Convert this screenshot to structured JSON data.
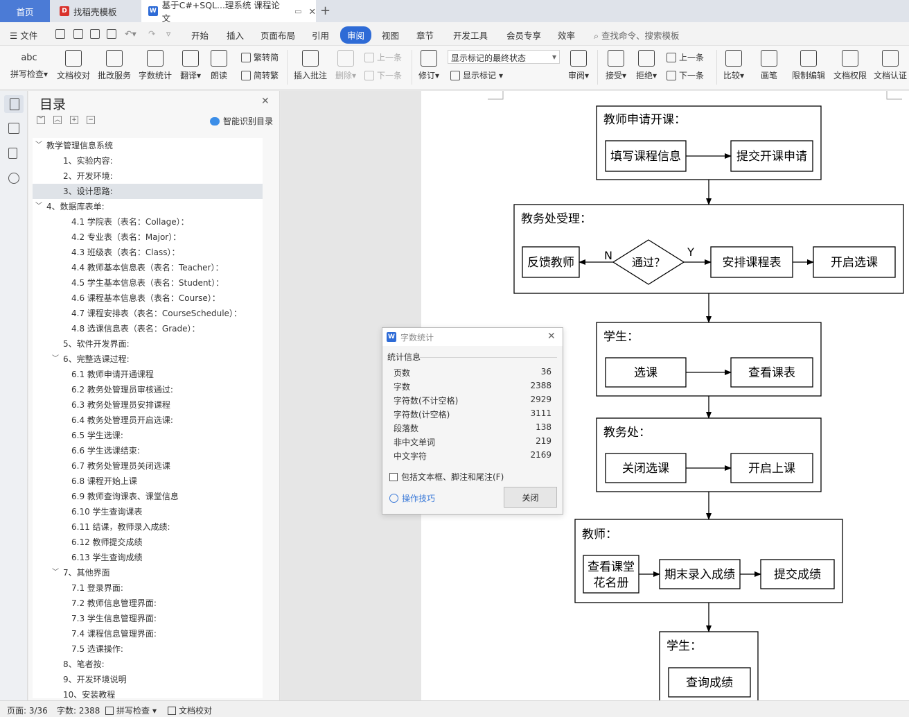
{
  "tabs": {
    "home": "首页",
    "template": "找稻壳模板",
    "doc": "基于C#+SQL...理系统 课程论文"
  },
  "menu": {
    "file": "文件",
    "items": [
      "开始",
      "插入",
      "页面布局",
      "引用",
      "审阅",
      "视图",
      "章节",
      "开发工具",
      "会员专享",
      "效率"
    ],
    "active": "审阅",
    "search": "查找命令、搜索模板"
  },
  "ribbon": {
    "spell": "拼写检查",
    "proof": "文档校对",
    "revise_service": "批改服务",
    "word_count": "字数统计",
    "translate": "翻译",
    "read": "朗读",
    "to_trad": "繁转简",
    "to_simp": "简转繁",
    "insert_comment": "插入批注",
    "delete": "删除",
    "prev": "上一条",
    "next": "下一条",
    "track": "修订",
    "markup_state": "显示标记的最终状态",
    "show_markup": "显示标记",
    "review": "审阅",
    "accept": "接受",
    "reject": "拒绝",
    "prev2": "上一条",
    "next2": "下一条",
    "compare": "比较",
    "pen": "画笔",
    "restrict": "限制编辑",
    "rights": "文档权限",
    "auth": "文档认证"
  },
  "toc": {
    "title": "目录",
    "smart": "智能识别目录",
    "items": [
      {
        "text": "教学管理信息系统",
        "level": 0,
        "arrow": "﹀"
      },
      {
        "text": "1、实验内容:",
        "level": 1
      },
      {
        "text": "2、开发环境:",
        "level": 1
      },
      {
        "text": "3、设计思路:",
        "level": 1,
        "selected": true
      },
      {
        "text": "4、数据库表单:",
        "level": 0,
        "arrow": "﹀"
      },
      {
        "text": "4.1  学院表（表名：Collage）：",
        "level": 2
      },
      {
        "text": "4.2  专业表（表名：Major）：",
        "level": 2
      },
      {
        "text": "4.3  班级表（表名：Class）：",
        "level": 2
      },
      {
        "text": "4.4  教师基本信息表（表名：Teacher）：",
        "level": 2
      },
      {
        "text": "4.5  学生基本信息表（表名：Student）：",
        "level": 2
      },
      {
        "text": "4.6  课程基本信息表（表名：Course）：",
        "level": 2
      },
      {
        "text": "4.7  课程安排表（表名：CourseSchedule）：",
        "level": 2
      },
      {
        "text": "4.8  选课信息表（表名：Grade）：",
        "level": 2
      },
      {
        "text": "5、软件开发界面:",
        "level": 1
      },
      {
        "text": "6、完整选课过程:",
        "level": 1,
        "arrow": "﹀"
      },
      {
        "text": "6.1  教师申请开通课程",
        "level": 2
      },
      {
        "text": "6.2  教务处管理员审核通过:",
        "level": 2
      },
      {
        "text": "6.3  教务处管理员安排课程",
        "level": 2
      },
      {
        "text": "6.4  教务处管理员开启选课:",
        "level": 2
      },
      {
        "text": "6.5  学生选课:",
        "level": 2
      },
      {
        "text": "6.6  学生选课结束:",
        "level": 2
      },
      {
        "text": "6.7  教务处管理员关闭选课",
        "level": 2
      },
      {
        "text": "6.8  课程开始上课",
        "level": 2
      },
      {
        "text": "6.9  教师查询课表、课堂信息",
        "level": 2
      },
      {
        "text": "6.10  学生查询课表",
        "level": 2
      },
      {
        "text": "6.11  结课，教师录入成绩:",
        "level": 2
      },
      {
        "text": "6.12  教师提交成绩",
        "level": 2
      },
      {
        "text": "6.13  学生查询成绩",
        "level": 2
      },
      {
        "text": "7、其他界面",
        "level": 1,
        "arrow": "﹀"
      },
      {
        "text": "7.1  登录界面:",
        "level": 2
      },
      {
        "text": "7.2  教师信息管理界面:",
        "level": 2
      },
      {
        "text": "7.3  学生信息管理界面:",
        "level": 2
      },
      {
        "text": "7.4  课程信息管理界面:",
        "level": 2
      },
      {
        "text": "7.5  选课操作:",
        "level": 2
      },
      {
        "text": "8、笔者按:",
        "level": 1
      },
      {
        "text": "9、开发环境说明",
        "level": 1
      },
      {
        "text": "10、安装教程",
        "level": 1
      }
    ]
  },
  "flow": {
    "g1_title": "教师申请开课：",
    "fill_info": "填写课程信息",
    "submit_apply": "提交开课申请",
    "g2_title": "教务处受理：",
    "feedback": "反馈教师",
    "pass": "通过？",
    "n": "N",
    "y": "Y",
    "arrange": "安排课程表",
    "open_select": "开启选课",
    "g3_title": "学生：",
    "select": "选课",
    "view_schedule": "查看课表",
    "g4_title": "教务处：",
    "close_select": "关闭选课",
    "start_class": "开启上课",
    "g5_title": "教师：",
    "roster_1": "查看课堂",
    "roster_2": "花名册",
    "enter_grades": "期末录入成绩",
    "submit_grades": "提交成绩",
    "g6_title": "学生：",
    "query_grades": "查询成绩"
  },
  "word_count": {
    "title": "字数统计",
    "section": "统计信息",
    "rows": [
      {
        "label": "页数",
        "value": "36"
      },
      {
        "label": "字数",
        "value": "2388"
      },
      {
        "label": "字符数(不计空格)",
        "value": "2929"
      },
      {
        "label": "字符数(计空格)",
        "value": "3111"
      },
      {
        "label": "段落数",
        "value": "138"
      },
      {
        "label": "非中文单词",
        "value": "219"
      },
      {
        "label": "中文字符",
        "value": "2169"
      }
    ],
    "include": "包括文本框、脚注和尾注(F)",
    "tips": "操作技巧",
    "close": "关闭"
  },
  "status": {
    "page": "页面: 3/36",
    "words": "字数: 2388",
    "spell": "拼写检查",
    "proof": "文档校对"
  }
}
